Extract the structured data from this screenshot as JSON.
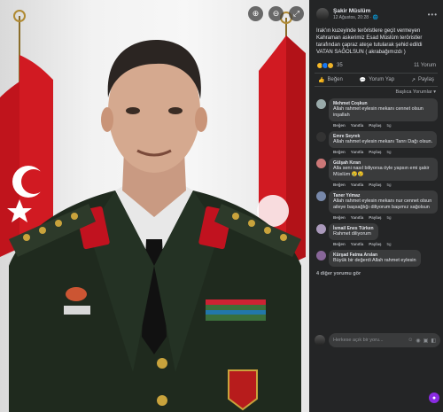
{
  "photo": {
    "toolbar": {
      "zoom_in_icon": "zoom-in-icon",
      "zoom_out_icon": "zoom-out-icon",
      "fullscreen_icon": "fullscreen-icon"
    }
  },
  "post": {
    "author": "Şakir Müslüm",
    "time": "12 Ağustos, 20:28 · 🌐",
    "text": "Irak'ın kuzeyinde teröristlere geçit vermeyen Kahraman askerimiz Esad Müslüm teröristler tarafından çapraz ateşe tutularak şehid edildi VATAN SAĞOLSUN ( akrabağımızdı )",
    "reaction_count": "35",
    "comment_count": "11 Yorum",
    "actions": {
      "like": "Beğen",
      "comment": "Yorum Yap",
      "share": "Paylaş"
    },
    "sort_label": "Başlıca Yorumlar ▾"
  },
  "comments": [
    {
      "name": "Mehmet Coşkun",
      "text": "Allah rahmet eylesin mekanı cennet olsun inşallah",
      "time": "5g"
    },
    {
      "name": "Emre Seyrek",
      "text": "Allah rahmet eylesin mekanı Tanrı Dağı olsun.",
      "time": "5g"
    },
    {
      "name": "Gülşah Kıran",
      "text": "Alla seni nasıl biliyorsa öyle yapsın emi şakir Müslüm 😢😢",
      "time": "5g"
    },
    {
      "name": "Taner Yılmaz",
      "text": "Allah rahmet eylesin mekanı nur cennet olsun aileye başsağlığı diliyorum başımız sağolsun",
      "time": "5g"
    },
    {
      "name": "İsmail Enes Türken",
      "text": "Rahmet diliyorum",
      "time": "5g"
    },
    {
      "name": "Kürşad Fatma Arslan",
      "text": "Büyük bir değerdi Allah rahmet eylesin",
      "time": "5g"
    }
  ],
  "comment_actions": {
    "like": "Beğen",
    "reply": "Yanıtla",
    "share": "Paylaş"
  },
  "more_comments": "4 diğer yorumu gör",
  "compose_placeholder": "Herkese açık bir yoru...",
  "colors": {
    "panel_bg": "#242526",
    "bubble_bg": "#3a3b3c",
    "text": "#e4e6eb",
    "muted": "#b0b3b8"
  }
}
